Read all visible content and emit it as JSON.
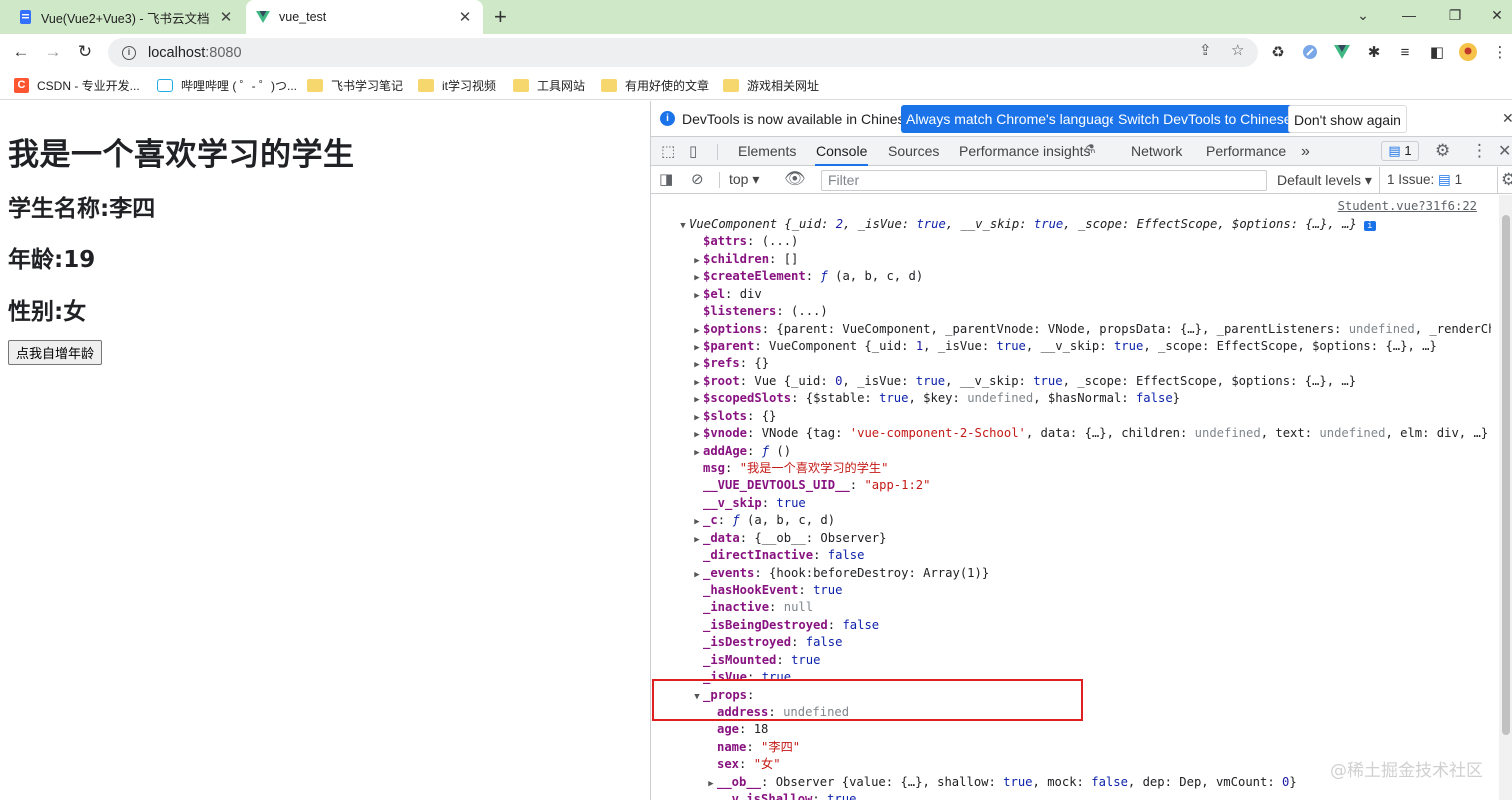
{
  "browser": {
    "tabs": [
      {
        "title": "Vue(Vue2+Vue3) - 飞书云文档",
        "favicon": "doc-icon",
        "active": false
      },
      {
        "title": "vue_test",
        "favicon": "vue-icon",
        "active": true
      }
    ],
    "new_tab": "+",
    "window_controls": {
      "dropdown": "⌄",
      "minimize": "—",
      "restore": "❐",
      "close": "✕"
    },
    "nav": {
      "back": "←",
      "forward": "→",
      "reload": "↻"
    },
    "address": {
      "host": "localhost",
      "port": ":8080"
    },
    "bookmarks": [
      {
        "label": "CSDN - 专业开发...",
        "icon": "csdn-icon"
      },
      {
        "label": "哔哩哔哩 ( ゜- ゜)つ...",
        "icon": "bilibili-icon"
      },
      {
        "label": "飞书学习笔记",
        "icon": "folder-icon"
      },
      {
        "label": "it学习视频",
        "icon": "folder-icon"
      },
      {
        "label": "工具网站",
        "icon": "folder-icon"
      },
      {
        "label": "有用好使的文章",
        "icon": "folder-icon"
      },
      {
        "label": "游戏相关网址",
        "icon": "folder-icon"
      }
    ]
  },
  "app": {
    "heading": "我是一个喜欢学习的学生",
    "name_line": "学生名称:李四",
    "age_line": "年龄:19",
    "sex_line": "性别:女",
    "button_label": "点我自增年龄"
  },
  "devtools": {
    "infobar": {
      "message": "DevTools is now available in Chinese!",
      "btn_match": "Always match Chrome's language",
      "btn_switch": "Switch DevTools to Chinese",
      "btn_dismiss": "Don't show again"
    },
    "tabs": [
      "Elements",
      "Console",
      "Sources",
      "Performance insights",
      "Network",
      "Performance"
    ],
    "active_tab": "Console",
    "more": "»",
    "message_badge": "1",
    "toolbar": {
      "context": "top",
      "filter_placeholder": "Filter",
      "levels": "Default levels",
      "issues_label": "1 Issue:",
      "issues_count": "1"
    },
    "source_link": "Student.vue?31f6:22",
    "lines": [
      "▼|VueComponent {_uid: 2, _isVue: true, __v_skip: true, _scope: EffectScope, $options: {…}, …}",
      "$attrs: (...)",
      "▶ $children: []",
      "▶ $createElement: ƒ (a, b, c, d)",
      "▶ $el: div",
      "$listeners: (...)",
      "▶ $options: {parent: VueComponent, _parentVnode: VNode, propsData: {…}, _parentListeners: undefined, _renderChi",
      "▶ $parent: VueComponent {_uid: 1, _isVue: true, __v_skip: true, _scope: EffectScope, $options: {…}, …}",
      "▶ $refs: {}",
      "▶ $root: Vue {_uid: 0, _isVue: true, __v_skip: true, _scope: EffectScope, $options: {…}, …}",
      "▶ $scopedSlots: {$stable: true, $key: undefined, $hasNormal: false}",
      "▶ $slots: {}",
      "▶ $vnode: VNode {tag: 'vue-component-2-School', data: {…}, children: undefined, text: undefined, elm: div, …}",
      "▶ addAge: ƒ ()",
      "msg: \"我是一个喜欢学习的学生\"",
      "__VUE_DEVTOOLS_UID__: \"app-1:2\"",
      "__v_skip: true",
      "▶ _c: ƒ (a, b, c, d)",
      "▶ _data: {__ob__: Observer}",
      "_directInactive: false",
      "▶ _events: {hook:beforeDestroy: Array(1)}",
      "_hasHookEvent: true",
      "_inactive: null",
      "_isBeingDestroyed: false",
      "_isDestroyed: false",
      "_isMounted: true",
      "_isVue: true",
      "▼ _props:",
      "address: undefined",
      "age: 18",
      "name: \"李四\"",
      "sex: \"女\"",
      "▶ __ob__: Observer {value: {…}, shallow: true, mock: false, dep: Dep, vmCount: 0}",
      "__v_isShallow: true"
    ]
  },
  "watermark": "@稀土掘金技术社区",
  "colors": {
    "tabstrip": "#cfe8c7",
    "accent": "#1a73e8",
    "highlight": "#e02020"
  }
}
